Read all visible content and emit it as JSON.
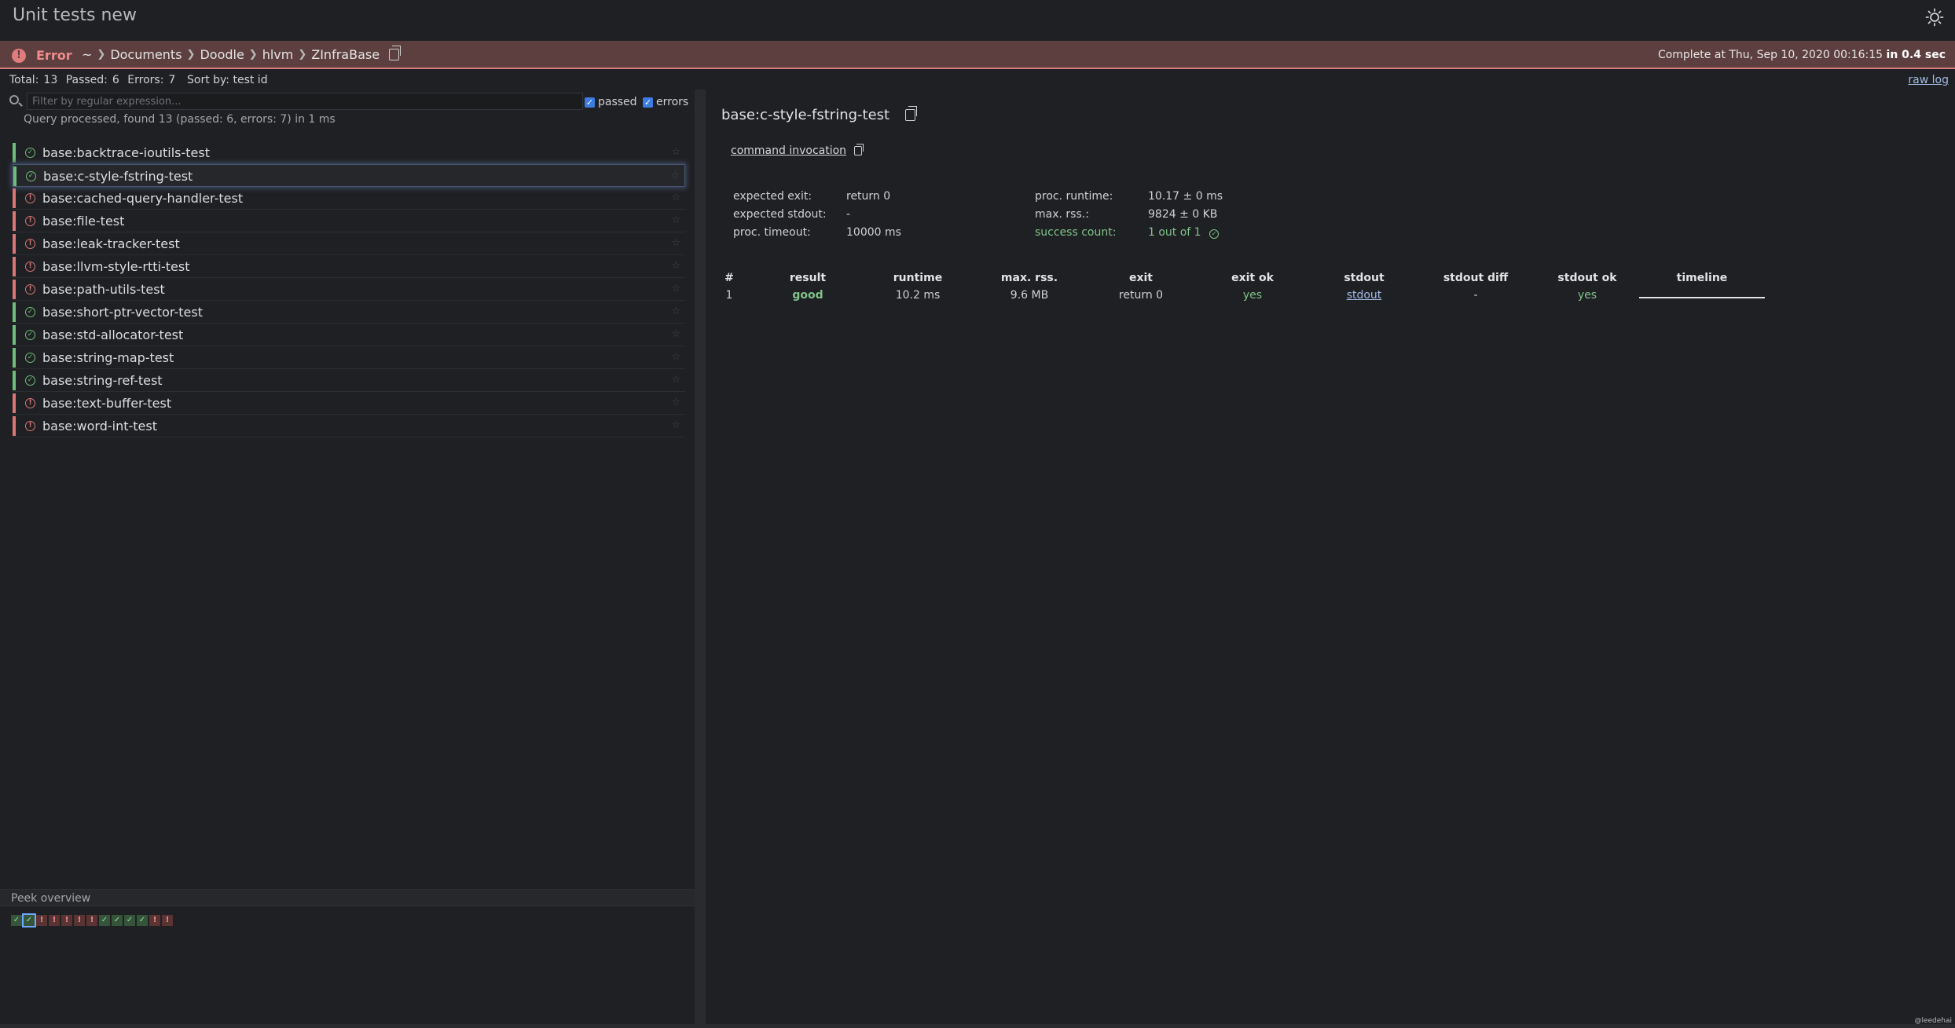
{
  "app": {
    "title": "Unit tests new"
  },
  "status_bar": {
    "status": "Error",
    "breadcrumbs": [
      "~",
      "Documents",
      "Doodle",
      "hlvm",
      "ZInfraBase"
    ],
    "complete_prefix": "Complete at Thu, Sep 10, 2020 00:16:15",
    "complete_duration": "in 0.4 sec"
  },
  "summary": {
    "total_label": "Total:",
    "total": "13",
    "passed_label": "Passed:",
    "passed": "6",
    "errors_label": "Errors:",
    "errors": "7",
    "sort_by": "Sort by: test id",
    "raw_log": "raw log"
  },
  "filter": {
    "placeholder": "Filter by regular expression...",
    "passed_label": "passed",
    "errors_label": "errors",
    "query_message": "Query processed, found 13 (passed: 6, errors: 7) in 1 ms"
  },
  "tests": [
    {
      "name": "base:backtrace-ioutils-test",
      "status": "pass"
    },
    {
      "name": "base:c-style-fstring-test",
      "status": "pass",
      "selected": true
    },
    {
      "name": "base:cached-query-handler-test",
      "status": "err"
    },
    {
      "name": "base:file-test",
      "status": "err"
    },
    {
      "name": "base:leak-tracker-test",
      "status": "err"
    },
    {
      "name": "base:llvm-style-rtti-test",
      "status": "err"
    },
    {
      "name": "base:path-utils-test",
      "status": "err"
    },
    {
      "name": "base:short-ptr-vector-test",
      "status": "pass"
    },
    {
      "name": "base:std-allocator-test",
      "status": "pass"
    },
    {
      "name": "base:string-map-test",
      "status": "pass"
    },
    {
      "name": "base:string-ref-test",
      "status": "pass"
    },
    {
      "name": "base:text-buffer-test",
      "status": "err"
    },
    {
      "name": "base:word-int-test",
      "status": "err"
    }
  ],
  "peek": {
    "title": "Peek overview"
  },
  "detail": {
    "title": "base:c-style-fstring-test",
    "command_invocation": "command invocation",
    "expected_exit_label": "expected exit:",
    "expected_exit": "return 0",
    "expected_stdout_label": "expected stdout:",
    "expected_stdout": "-",
    "proc_timeout_label": "proc. timeout:",
    "proc_timeout": "10000 ms",
    "proc_runtime_label": "proc. runtime:",
    "proc_runtime": "10.17 ± 0 ms",
    "max_rss_label": "max. rss.:",
    "max_rss": "9824 ± 0 KB",
    "success_count_label": "success count:",
    "success_count": "1 out of 1"
  },
  "results": {
    "headers": [
      "#",
      "result",
      "runtime",
      "max. rss.",
      "exit",
      "exit ok",
      "stdout",
      "stdout diff",
      "stdout ok",
      "timeline"
    ],
    "row": [
      "1",
      "good",
      "10.2 ms",
      "9.6 MB",
      "return 0",
      "yes",
      "stdout",
      "-",
      "yes"
    ]
  },
  "credit": "@leedehai",
  "colors": {
    "pass": "#6fbf7a",
    "error": "#d97777",
    "error_bar": "#5e3f3f",
    "link": "#a3bbe6"
  }
}
